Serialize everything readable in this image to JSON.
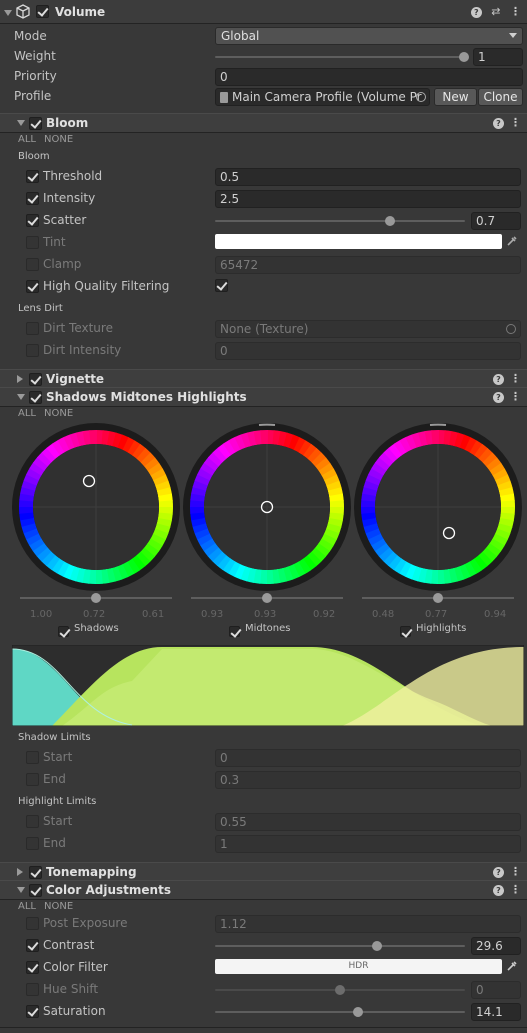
{
  "volume": {
    "title": "Volume",
    "mode_label": "Mode",
    "mode_value": "Global",
    "weight_label": "Weight",
    "weight_value": "1",
    "weight_fraction": 1.0,
    "priority_label": "Priority",
    "priority_value": "0",
    "profile_label": "Profile",
    "profile_value": "Main Camera Profile (Volume Pr",
    "new_label": "New",
    "clone_label": "Clone"
  },
  "bloom": {
    "title": "Bloom",
    "all": "ALL",
    "none": "NONE",
    "section_bloom": "Bloom",
    "threshold_label": "Threshold",
    "threshold_value": "0.5",
    "intensity_label": "Intensity",
    "intensity_value": "2.5",
    "scatter_label": "Scatter",
    "scatter_value": "0.7",
    "scatter_fraction": 0.7,
    "tint_label": "Tint",
    "clamp_label": "Clamp",
    "clamp_value": "65472",
    "hq_label": "High Quality Filtering",
    "section_lens": "Lens Dirt",
    "dirt_texture_label": "Dirt Texture",
    "dirt_texture_value": "None (Texture)",
    "dirt_intensity_label": "Dirt Intensity",
    "dirt_intensity_value": "0"
  },
  "vignette": {
    "title": "Vignette"
  },
  "smh": {
    "title": "Shadows Midtones Highlights",
    "all": "ALL",
    "none": "NONE",
    "wheels": [
      {
        "label": "Shadows",
        "nums": [
          "1.00",
          "0.72",
          "0.61"
        ]
      },
      {
        "label": "Midtones",
        "nums": [
          "0.93",
          "0.93",
          "0.92"
        ]
      },
      {
        "label": "Highlights",
        "nums": [
          "0.48",
          "0.77",
          "0.94"
        ]
      }
    ],
    "shadow_limits": "Shadow Limits",
    "s_start_label": "Start",
    "s_start_value": "0",
    "s_end_label": "End",
    "s_end_value": "0.3",
    "highlight_limits": "Highlight Limits",
    "h_start_label": "Start",
    "h_start_value": "0.55",
    "h_end_label": "End",
    "h_end_value": "1"
  },
  "tonemapping": {
    "title": "Tonemapping"
  },
  "color_adj": {
    "title": "Color Adjustments",
    "all": "ALL",
    "none": "NONE",
    "post_exposure_label": "Post Exposure",
    "post_exposure_value": "1.12",
    "contrast_label": "Contrast",
    "contrast_value": "29.6",
    "contrast_fraction": 0.648,
    "color_filter_label": "Color Filter",
    "color_filter_value": "HDR",
    "hue_shift_label": "Hue Shift",
    "hue_shift_value": "0",
    "hue_fraction": 0.5,
    "saturation_label": "Saturation",
    "saturation_value": "14.1",
    "saturation_fraction": 0.57
  },
  "colors": {
    "background": "#383838",
    "header": "#3c3c3c",
    "field": "#2a2a2a",
    "tint": "#ffffff"
  }
}
